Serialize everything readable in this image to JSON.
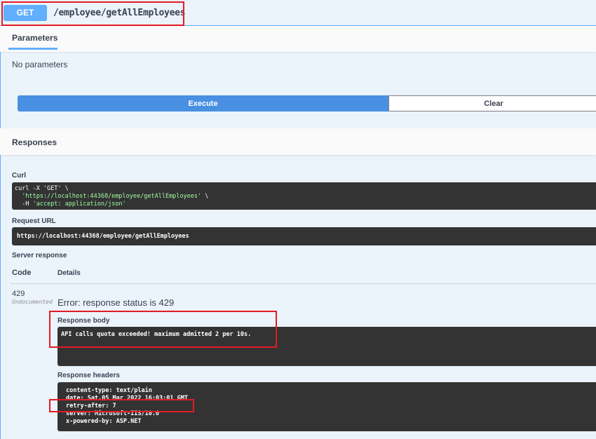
{
  "summary": {
    "method": "GET",
    "path": "/employee/getAllEmployees"
  },
  "parameters": {
    "tab_label": "Parameters",
    "empty_text": "No parameters"
  },
  "actions": {
    "execute_label": "Execute",
    "clear_label": "Clear"
  },
  "responses": {
    "title": "Responses",
    "curl": {
      "label": "Curl",
      "line1": "curl -X 'GET' \\",
      "line2_url": "'https://localhost:44368/employee/getAllEmployees'",
      "line2_suffix": " \\",
      "line3_prefix": "-H ",
      "line3_header": "'accept: application/json'"
    },
    "request_url": {
      "label": "Request URL",
      "value": "https://localhost:44368/employee/getAllEmployees"
    },
    "server_response": {
      "label": "Server response",
      "code_header": "Code",
      "details_header": "Details",
      "code": "429",
      "undocumented": "Undocumented",
      "error": "Error: response status is 429",
      "body_label": "Response body",
      "body": "API calls quota exceeded! maximum admitted 2 per 10s.",
      "headers_label": "Response headers",
      "headers": [
        "content-type: text/plain",
        "date: Sat,05 Mar 2022 16:03:01 GMT",
        "retry-after: 7",
        "server: Microsoft-IIS/10.0",
        "x-powered-by: ASP.NET"
      ]
    }
  },
  "colors": {
    "get_accent": "#61affe",
    "execute_blue": "#4990e2",
    "highlight_red": "#e31b23",
    "code_bg": "#333333"
  }
}
